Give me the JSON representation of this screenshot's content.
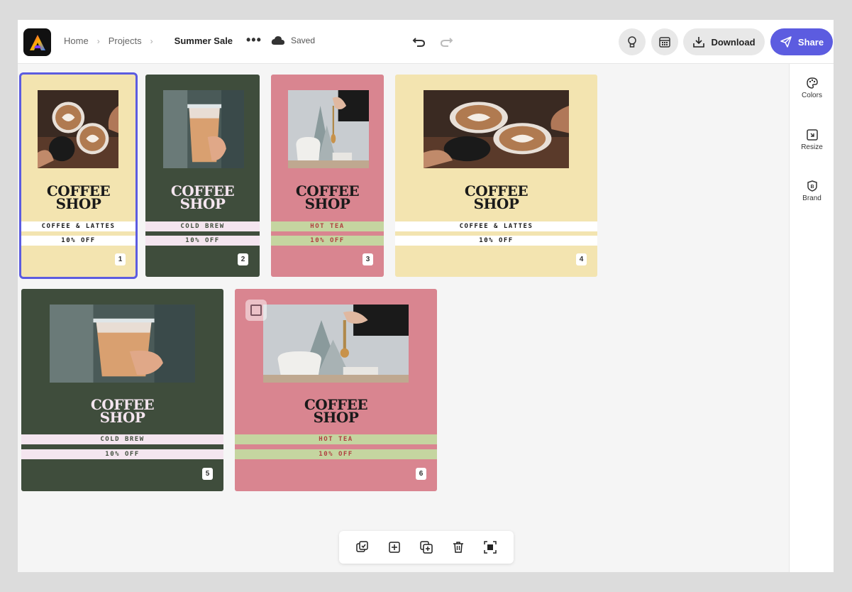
{
  "breadcrumb": {
    "home": "Home",
    "projects": "Projects",
    "current": "Summer Sale"
  },
  "status": {
    "saved": "Saved"
  },
  "toolbar": {
    "download_label": "Download",
    "share_label": "Share"
  },
  "side_panel": {
    "colors": "Colors",
    "resize": "Resize",
    "brand": "Brand"
  },
  "colors": {
    "accent": "#5c5ce0",
    "yellow": "#f3e4b0",
    "green": "#3f4d3c",
    "pink": "#d98590",
    "light_green": "#c5d5a0",
    "light_pink": "#f4e5ef"
  },
  "cards": [
    {
      "title_line1": "COFFEE",
      "title_line2": "SHOP",
      "strip1": "COFFEE & LATTES",
      "strip2": "10% OFF",
      "page": "1"
    },
    {
      "title_line1": "COFFEE",
      "title_line2": "SHOP",
      "strip1": "COLD BREW",
      "strip2": "10% OFF",
      "page": "2"
    },
    {
      "title_line1": "COFFEE",
      "title_line2": "SHOP",
      "strip1": "HOT TEA",
      "strip2": "10% OFF",
      "page": "3"
    },
    {
      "title_line1": "COFFEE",
      "title_line2": "SHOP",
      "strip1": "COFFEE & LATTES",
      "strip2": "10% OFF",
      "page": "4"
    },
    {
      "title_line1": "COFFEE",
      "title_line2": "SHOP",
      "strip1": "COLD BREW",
      "strip2": "10% OFF",
      "page": "5"
    },
    {
      "title_line1": "COFFEE",
      "title_line2": "SHOP",
      "strip1": "HOT TEA",
      "strip2": "10% OFF",
      "page": "6"
    }
  ]
}
